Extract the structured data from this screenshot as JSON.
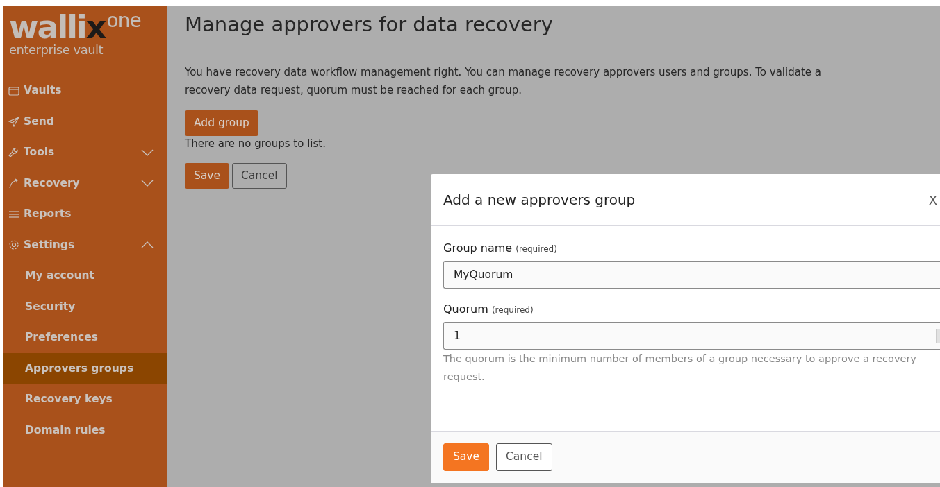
{
  "logo": {
    "word": "walli",
    "mark": "x",
    "suffix": "one",
    "tagline": "enterprise vault"
  },
  "sidebar": {
    "items": [
      {
        "label": "Vaults",
        "selected": false
      },
      {
        "label": "Send",
        "selected": false
      },
      {
        "label": "Tools",
        "selected": false,
        "expanded": false
      },
      {
        "label": "Recovery",
        "selected": false,
        "expanded": false
      },
      {
        "label": "Reports",
        "selected": false
      },
      {
        "label": "Settings",
        "selected": false,
        "expanded": true,
        "children": [
          {
            "label": "My account",
            "selected": false
          },
          {
            "label": "Security",
            "selected": false
          },
          {
            "label": "Preferences",
            "selected": false
          },
          {
            "label": "Approvers groups",
            "selected": true
          },
          {
            "label": "Recovery keys",
            "selected": false
          },
          {
            "label": "Domain rules",
            "selected": false
          }
        ]
      }
    ]
  },
  "page": {
    "title": "Manage approvers for data recovery",
    "description": "You have recovery data workflow management right. You can manage recovery approvers users and groups. To validate a recovery data request, quorum must be reached for each group.",
    "add_button": "Add group",
    "empty_message": "There are no groups to list.",
    "buttons": [
      "Save",
      "Cancel"
    ]
  },
  "modal": {
    "title": "Add a new approvers group",
    "close": "X",
    "fields": [
      {
        "label": "Group name",
        "note": "(required)",
        "value": "MyQuorum",
        "kind": "text"
      },
      {
        "label": "Quorum",
        "note": "(required)",
        "value": "1",
        "kind": "number",
        "help": "The quorum is the minimum number of members of a group necessary to approve a recovery request."
      }
    ],
    "buttons": [
      "Save",
      "Cancel"
    ]
  }
}
